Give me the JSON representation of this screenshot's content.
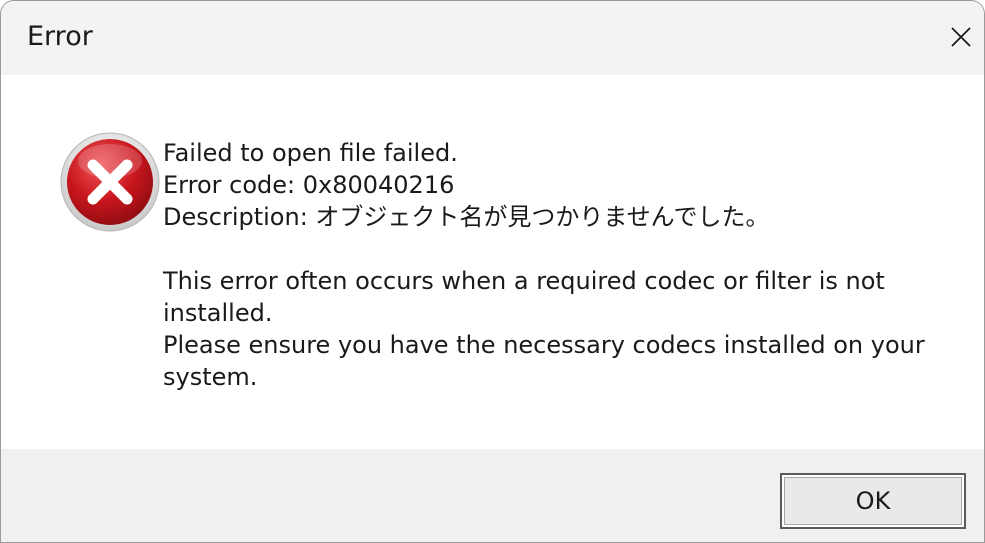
{
  "dialog": {
    "title": "Error",
    "close_icon": "close-icon",
    "icon": "error-icon",
    "message": {
      "line1": "Failed to open file failed.",
      "line2": "Error code: 0x80040216",
      "line3": "Description: オブジェクト名が見つかりませんでした。",
      "paragraph2": "This error often occurs when a required codec or filter is not installed.",
      "paragraph3": "Please ensure you have the necessary codecs installed on your system."
    },
    "ok_label": "OK"
  },
  "colors": {
    "titlebar_bg": "#f3f3f3",
    "footer_bg": "#f0f0f0",
    "error_red": "#c8161d",
    "text": "#1a1a1a"
  }
}
